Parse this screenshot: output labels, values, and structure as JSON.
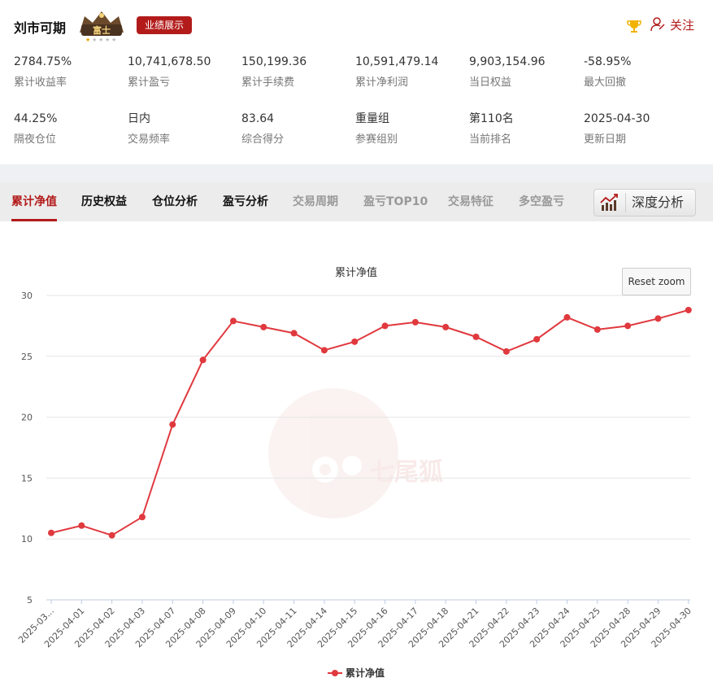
{
  "header": {
    "trader_name": "刘市可期",
    "rank_badge_icon": "fushi-rank-badge",
    "rank_badge_text": "富士",
    "performance_button": "业绩展示",
    "follow_label": "关注",
    "colors": {
      "accent": "#b31b1b"
    }
  },
  "stats": [
    {
      "value": "2784.75%",
      "label": "累计收益率"
    },
    {
      "value": "10,741,678.50",
      "label": "累计盈亏"
    },
    {
      "value": "150,199.36",
      "label": "累计手续费"
    },
    {
      "value": "10,591,479.14",
      "label": "累计净利润"
    },
    {
      "value": "9,903,154.96",
      "label": "当日权益"
    },
    {
      "value": "-58.95%",
      "label": "最大回撤"
    },
    {
      "value": "44.25%",
      "label": "隔夜仓位"
    },
    {
      "value": "日内",
      "label": "交易频率"
    },
    {
      "value": "83.64",
      "label": "综合得分"
    },
    {
      "value": "重量组",
      "label": "参赛组别"
    },
    {
      "value": "第110名",
      "label": "当前排名"
    },
    {
      "value": "2025-04-30",
      "label": "更新日期"
    }
  ],
  "tabs": [
    {
      "label": "累计净值",
      "state": "active"
    },
    {
      "label": "历史权益",
      "state": "normal"
    },
    {
      "label": "仓位分析",
      "state": "normal"
    },
    {
      "label": "盈亏分析",
      "state": "normal"
    },
    {
      "label": "交易周期",
      "state": "dim"
    },
    {
      "label": "盈亏TOP10",
      "state": "dim"
    },
    {
      "label": "交易特征",
      "state": "dim"
    },
    {
      "label": "多空盈亏",
      "state": "dim"
    }
  ],
  "deep_analysis_button": "深度分析",
  "reset_zoom_label": "Reset zoom",
  "chart_data": {
    "type": "line",
    "title": "累计净值",
    "categories": [
      "2025-03...",
      "2025-04-01",
      "2025-04-02",
      "2025-04-03",
      "2025-04-07",
      "2025-04-08",
      "2025-04-09",
      "2025-04-10",
      "2025-04-11",
      "2025-04-14",
      "2025-04-15",
      "2025-04-16",
      "2025-04-17",
      "2025-04-18",
      "2025-04-21",
      "2025-04-22",
      "2025-04-23",
      "2025-04-24",
      "2025-04-25",
      "2025-04-28",
      "2025-04-29",
      "2025-04-30"
    ],
    "series": [
      {
        "name": "累计净值",
        "color": "#e0393e",
        "values": [
          10.5,
          11.1,
          10.3,
          11.8,
          19.4,
          24.7,
          27.9,
          27.4,
          26.9,
          25.5,
          26.2,
          27.5,
          27.8,
          27.4,
          26.6,
          25.4,
          26.4,
          28.2,
          27.2,
          27.5,
          28.1,
          28.8
        ]
      }
    ],
    "yticks": [
      5,
      10,
      15,
      20,
      25,
      30
    ],
    "ylim": [
      5,
      30
    ],
    "grid": true,
    "legend_position": "bottom-center",
    "watermark": "七尾狐"
  }
}
